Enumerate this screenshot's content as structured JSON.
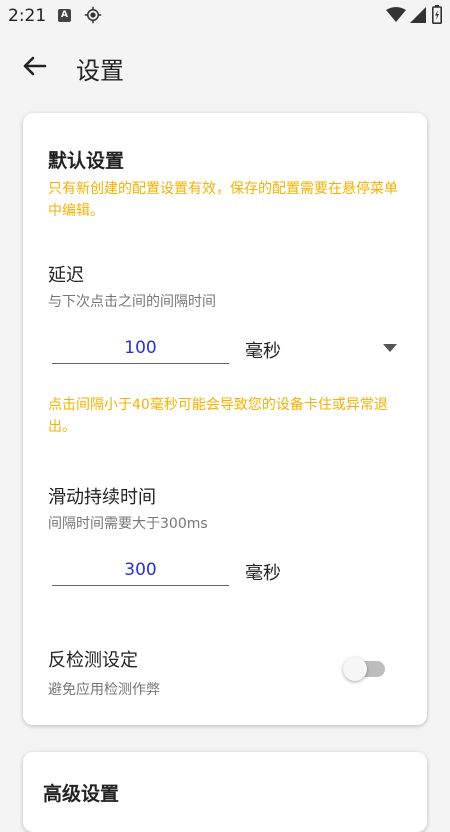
{
  "status_bar": {
    "time": "2:21",
    "keyboard_badge": "A",
    "icons": [
      "keyboard-a-icon",
      "gps-icon",
      "wifi-icon",
      "signal-icon",
      "battery-charging-icon"
    ]
  },
  "app_bar": {
    "back_icon": "arrow-left-icon",
    "title": "设置"
  },
  "default_settings": {
    "title": "默认设置",
    "notice": "只有新创建的配置设置有效，保存的配置需要在悬停菜单中编辑。",
    "delay": {
      "title": "延迟",
      "subtitle": "与下次点击之间的间隔时间",
      "value": "100",
      "unit": "毫秒",
      "warning": "点击间隔小于40毫秒可能会导致您的设备卡住或异常退出。"
    },
    "swipe": {
      "title": "滑动持续时间",
      "subtitle": "间隔时间需要大于300ms",
      "value": "300",
      "unit": "毫秒"
    },
    "anti_detect": {
      "title": "反检测设定",
      "subtitle": "避免应用检测作弊",
      "enabled": false
    }
  },
  "advanced_settings": {
    "title": "高级设置"
  },
  "colors": {
    "warning": "#f6b000",
    "input_value": "#2630d8",
    "background": "#f4f4f4",
    "card": "#ffffff"
  }
}
